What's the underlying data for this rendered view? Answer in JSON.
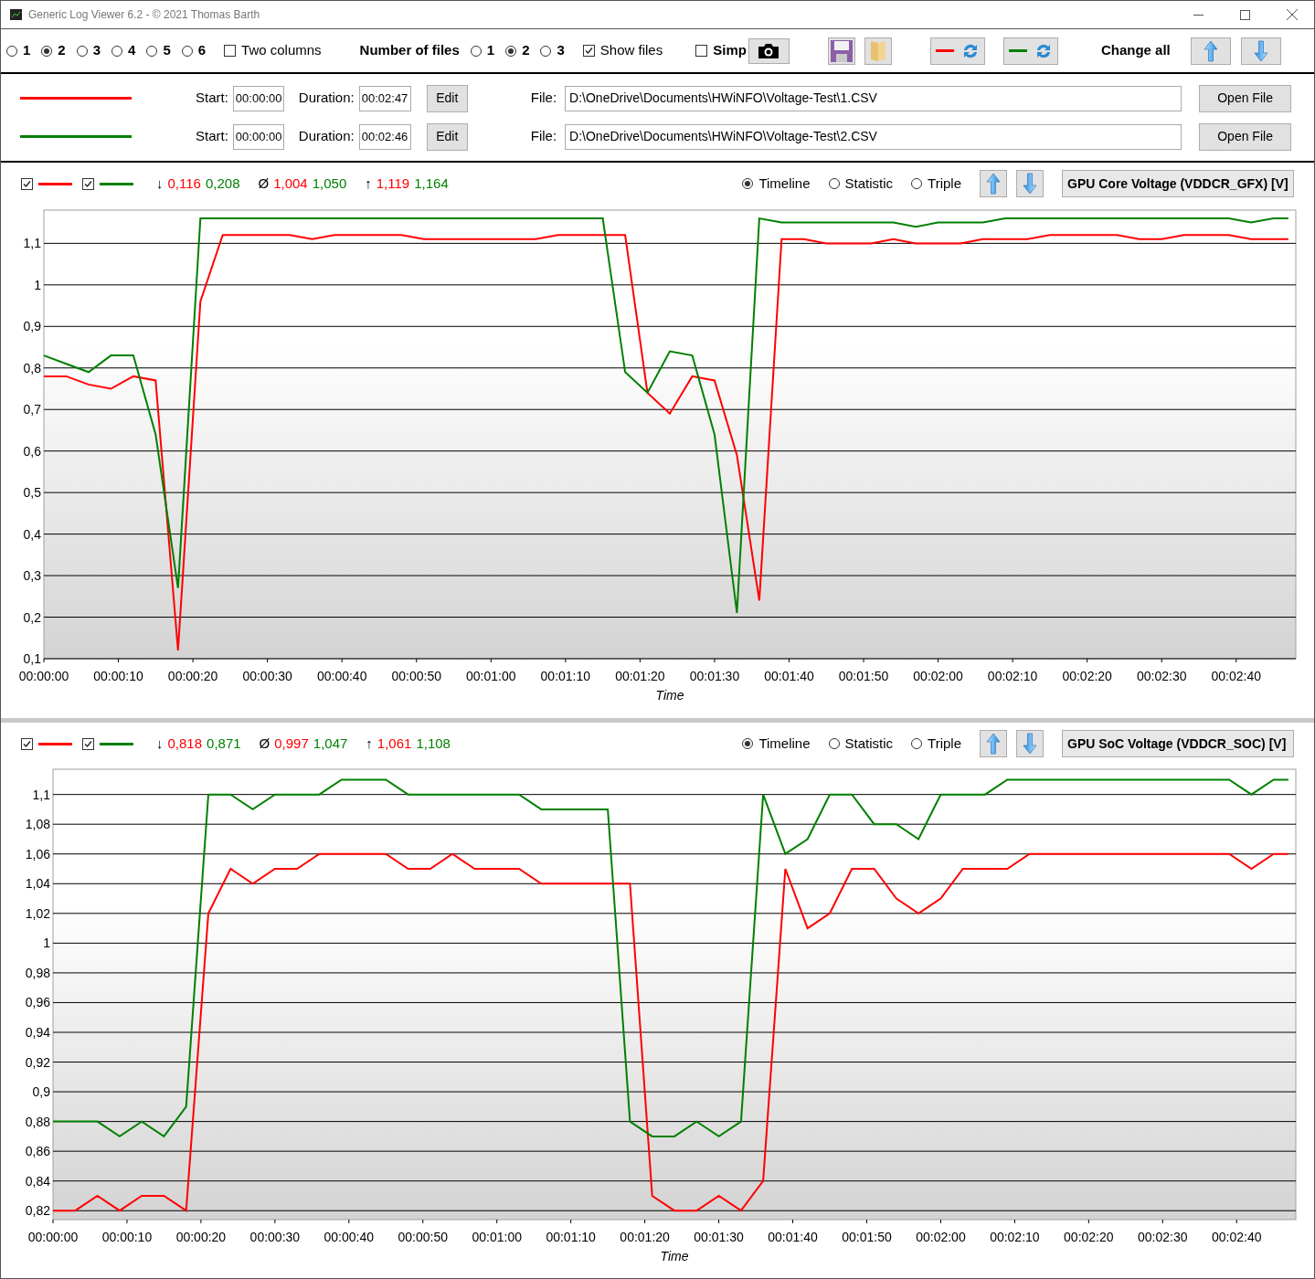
{
  "window": {
    "title": "Generic Log Viewer 6.2 - © 2021 Thomas Barth"
  },
  "toolbar": {
    "layouts": [
      {
        "label": "1",
        "selected": false
      },
      {
        "label": "2",
        "selected": true
      },
      {
        "label": "3",
        "selected": false
      },
      {
        "label": "4",
        "selected": false
      },
      {
        "label": "5",
        "selected": false
      },
      {
        "label": "6",
        "selected": false
      }
    ],
    "two_columns": {
      "label": "Two columns",
      "checked": false
    },
    "number_of_files": {
      "label": "Number of files",
      "options": [
        {
          "label": "1",
          "selected": false
        },
        {
          "label": "2",
          "selected": true
        },
        {
          "label": "3",
          "selected": false
        }
      ]
    },
    "show_files": {
      "label": "Show files",
      "checked": true
    },
    "simple": {
      "label": "Simp",
      "checked": false
    },
    "change_all": {
      "label": "Change all"
    }
  },
  "files": [
    {
      "color": "#ff0000",
      "start_label": "Start:",
      "start": "00:00:00",
      "duration_label": "Duration:",
      "duration": "00:02:47",
      "edit": "Edit",
      "file_label": "File:",
      "path": "D:\\OneDrive\\Documents\\HWiNFO\\Voltage-Test\\1.CSV",
      "open": "Open File"
    },
    {
      "color": "#008000",
      "start_label": "Start:",
      "start": "00:00:00",
      "duration_label": "Duration:",
      "duration": "00:02:46",
      "edit": "Edit",
      "file_label": "File:",
      "path": "D:\\OneDrive\\Documents\\HWiNFO\\Voltage-Test\\2.CSV",
      "open": "Open File"
    }
  ],
  "charts": [
    {
      "toggles": [
        {
          "checked": true,
          "color": "#ff0000"
        },
        {
          "checked": true,
          "color": "#008000"
        }
      ],
      "stats": [
        {
          "symbol": "↓",
          "values": [
            {
              "text": "0,116",
              "color": "#ff0000"
            },
            {
              "text": "0,208",
              "color": "#008000"
            }
          ]
        },
        {
          "symbol": "Ø",
          "values": [
            {
              "text": "1,004",
              "color": "#ff0000"
            },
            {
              "text": "1,050",
              "color": "#008000"
            }
          ]
        },
        {
          "symbol": "↑",
          "values": [
            {
              "text": "1,119",
              "color": "#ff0000"
            },
            {
              "text": "1,164",
              "color": "#008000"
            }
          ]
        }
      ],
      "modes": [
        {
          "label": "Timeline",
          "selected": true
        },
        {
          "label": "Statistic",
          "selected": false
        },
        {
          "label": "Triple",
          "selected": false
        }
      ],
      "sensor": "GPU Core Voltage (VDDCR_GFX) [V]",
      "chart_data": {
        "type": "line",
        "grid": true,
        "xlabel": "Time",
        "xlim": [
          0,
          168
        ],
        "ylim": [
          0.1,
          1.18
        ],
        "x": [
          0,
          3,
          6,
          9,
          12,
          15,
          18,
          21,
          24,
          27,
          30,
          33,
          36,
          39,
          42,
          45,
          48,
          51,
          54,
          57,
          60,
          63,
          66,
          69,
          72,
          75,
          78,
          81,
          84,
          87,
          90,
          93,
          96,
          99,
          102,
          105,
          108,
          111,
          114,
          117,
          120,
          123,
          126,
          129,
          132,
          135,
          138,
          141,
          144,
          147,
          150,
          153,
          156,
          159,
          162,
          165,
          167
        ],
        "series": [
          {
            "color": "#ff0000",
            "values": [
              0.78,
              0.78,
              0.76,
              0.75,
              0.78,
              0.77,
              0.12,
              0.96,
              1.12,
              1.12,
              1.12,
              1.12,
              1.11,
              1.12,
              1.12,
              1.12,
              1.12,
              1.11,
              1.11,
              1.11,
              1.11,
              1.11,
              1.11,
              1.12,
              1.12,
              1.12,
              1.12,
              0.74,
              0.69,
              0.78,
              0.77,
              0.59,
              0.24,
              1.11,
              1.11,
              1.1,
              1.1,
              1.1,
              1.11,
              1.1,
              1.1,
              1.1,
              1.11,
              1.11,
              1.11,
              1.12,
              1.12,
              1.12,
              1.12,
              1.11,
              1.11,
              1.12,
              1.12,
              1.12,
              1.11,
              1.11,
              1.11
            ]
          },
          {
            "color": "#008000",
            "values": [
              0.83,
              0.81,
              0.79,
              0.83,
              0.83,
              0.64,
              0.27,
              1.16,
              1.16,
              1.16,
              1.16,
              1.16,
              1.16,
              1.16,
              1.16,
              1.16,
              1.16,
              1.16,
              1.16,
              1.16,
              1.16,
              1.16,
              1.16,
              1.16,
              1.16,
              1.16,
              0.79,
              0.74,
              0.84,
              0.83,
              0.64,
              0.21,
              1.16,
              1.15,
              1.15,
              1.15,
              1.15,
              1.15,
              1.15,
              1.14,
              1.15,
              1.15,
              1.15,
              1.16,
              1.16,
              1.16,
              1.16,
              1.16,
              1.16,
              1.16,
              1.16,
              1.16,
              1.16,
              1.16,
              1.15,
              1.16,
              1.16
            ]
          }
        ],
        "xticks": [
          {
            "value": 0,
            "label": "00:00:00"
          },
          {
            "value": 10,
            "label": "00:00:10"
          },
          {
            "value": 20,
            "label": "00:00:20"
          },
          {
            "value": 30,
            "label": "00:00:30"
          },
          {
            "value": 40,
            "label": "00:00:40"
          },
          {
            "value": 50,
            "label": "00:00:50"
          },
          {
            "value": 60,
            "label": "00:01:00"
          },
          {
            "value": 70,
            "label": "00:01:10"
          },
          {
            "value": 80,
            "label": "00:01:20"
          },
          {
            "value": 90,
            "label": "00:01:30"
          },
          {
            "value": 100,
            "label": "00:01:40"
          },
          {
            "value": 110,
            "label": "00:01:50"
          },
          {
            "value": 120,
            "label": "00:02:00"
          },
          {
            "value": 130,
            "label": "00:02:10"
          },
          {
            "value": 140,
            "label": "00:02:20"
          },
          {
            "value": 150,
            "label": "00:02:30"
          },
          {
            "value": 160,
            "label": "00:02:40"
          }
        ],
        "yticks": [
          {
            "value": 0.1,
            "label": "0,1"
          },
          {
            "value": 0.2,
            "label": "0,2"
          },
          {
            "value": 0.3,
            "label": "0,3"
          },
          {
            "value": 0.4,
            "label": "0,4"
          },
          {
            "value": 0.5,
            "label": "0,5"
          },
          {
            "value": 0.6,
            "label": "0,6"
          },
          {
            "value": 0.7,
            "label": "0,7"
          },
          {
            "value": 0.8,
            "label": "0,8"
          },
          {
            "value": 0.9,
            "label": "0,9"
          },
          {
            "value": 1,
            "label": "1"
          },
          {
            "value": 1.1,
            "label": "1,1"
          }
        ]
      }
    },
    {
      "toggles": [
        {
          "checked": true,
          "color": "#ff0000"
        },
        {
          "checked": true,
          "color": "#008000"
        }
      ],
      "stats": [
        {
          "symbol": "↓",
          "values": [
            {
              "text": "0,818",
              "color": "#ff0000"
            },
            {
              "text": "0,871",
              "color": "#008000"
            }
          ]
        },
        {
          "symbol": "Ø",
          "values": [
            {
              "text": "0,997",
              "color": "#ff0000"
            },
            {
              "text": "1,047",
              "color": "#008000"
            }
          ]
        },
        {
          "symbol": "↑",
          "values": [
            {
              "text": "1,061",
              "color": "#ff0000"
            },
            {
              "text": "1,108",
              "color": "#008000"
            }
          ]
        }
      ],
      "modes": [
        {
          "label": "Timeline",
          "selected": true
        },
        {
          "label": "Statistic",
          "selected": false
        },
        {
          "label": "Triple",
          "selected": false
        }
      ],
      "sensor": "GPU SoC Voltage (VDDCR_SOC) [V]",
      "chart_data": {
        "type": "line",
        "grid": true,
        "xlabel": "Time",
        "xlim": [
          0,
          168
        ],
        "ylim": [
          0.814,
          1.117
        ],
        "x": [
          0,
          3,
          6,
          9,
          12,
          15,
          18,
          21,
          24,
          27,
          30,
          33,
          36,
          39,
          42,
          45,
          48,
          51,
          54,
          57,
          60,
          63,
          66,
          69,
          72,
          75,
          78,
          81,
          84,
          87,
          90,
          93,
          96,
          99,
          102,
          105,
          108,
          111,
          114,
          117,
          120,
          123,
          126,
          129,
          132,
          135,
          138,
          141,
          144,
          147,
          150,
          153,
          156,
          159,
          162,
          165,
          167
        ],
        "series": [
          {
            "color": "#ff0000",
            "values": [
              0.82,
              0.82,
              0.83,
              0.82,
              0.83,
              0.83,
              0.82,
              1.02,
              1.05,
              1.04,
              1.05,
              1.05,
              1.06,
              1.06,
              1.06,
              1.06,
              1.05,
              1.05,
              1.06,
              1.05,
              1.05,
              1.05,
              1.04,
              1.04,
              1.04,
              1.04,
              1.04,
              0.83,
              0.82,
              0.82,
              0.83,
              0.82,
              0.84,
              1.05,
              1.01,
              1.02,
              1.05,
              1.05,
              1.03,
              1.02,
              1.03,
              1.05,
              1.05,
              1.05,
              1.06,
              1.06,
              1.06,
              1.06,
              1.06,
              1.06,
              1.06,
              1.06,
              1.06,
              1.06,
              1.05,
              1.06,
              1.06
            ]
          },
          {
            "color": "#008000",
            "values": [
              0.88,
              0.88,
              0.88,
              0.87,
              0.88,
              0.87,
              0.89,
              1.1,
              1.1,
              1.09,
              1.1,
              1.1,
              1.1,
              1.11,
              1.11,
              1.11,
              1.1,
              1.1,
              1.1,
              1.1,
              1.1,
              1.1,
              1.09,
              1.09,
              1.09,
              1.09,
              0.88,
              0.87,
              0.87,
              0.88,
              0.87,
              0.88,
              1.1,
              1.06,
              1.07,
              1.1,
              1.1,
              1.08,
              1.08,
              1.07,
              1.1,
              1.1,
              1.1,
              1.11,
              1.11,
              1.11,
              1.11,
              1.11,
              1.11,
              1.11,
              1.11,
              1.11,
              1.11,
              1.11,
              1.1,
              1.11,
              1.11
            ]
          }
        ],
        "xticks": [
          {
            "value": 0,
            "label": "00:00:00"
          },
          {
            "value": 10,
            "label": "00:00:10"
          },
          {
            "value": 20,
            "label": "00:00:20"
          },
          {
            "value": 30,
            "label": "00:00:30"
          },
          {
            "value": 40,
            "label": "00:00:40"
          },
          {
            "value": 50,
            "label": "00:00:50"
          },
          {
            "value": 60,
            "label": "00:01:00"
          },
          {
            "value": 70,
            "label": "00:01:10"
          },
          {
            "value": 80,
            "label": "00:01:20"
          },
          {
            "value": 90,
            "label": "00:01:30"
          },
          {
            "value": 100,
            "label": "00:01:40"
          },
          {
            "value": 110,
            "label": "00:01:50"
          },
          {
            "value": 120,
            "label": "00:02:00"
          },
          {
            "value": 130,
            "label": "00:02:10"
          },
          {
            "value": 140,
            "label": "00:02:20"
          },
          {
            "value": 150,
            "label": "00:02:30"
          },
          {
            "value": 160,
            "label": "00:02:40"
          }
        ],
        "yticks": [
          {
            "value": 0.82,
            "label": "0,82"
          },
          {
            "value": 0.84,
            "label": "0,84"
          },
          {
            "value": 0.86,
            "label": "0,86"
          },
          {
            "value": 0.88,
            "label": "0,88"
          },
          {
            "value": 0.9,
            "label": "0,9"
          },
          {
            "value": 0.92,
            "label": "0,92"
          },
          {
            "value": 0.94,
            "label": "0,94"
          },
          {
            "value": 0.96,
            "label": "0,96"
          },
          {
            "value": 0.98,
            "label": "0,98"
          },
          {
            "value": 1,
            "label": "1"
          },
          {
            "value": 1.02,
            "label": "1,02"
          },
          {
            "value": 1.04,
            "label": "1,04"
          },
          {
            "value": 1.06,
            "label": "1,06"
          },
          {
            "value": 1.08,
            "label": "1,08"
          },
          {
            "value": 1.1,
            "label": "1,1"
          }
        ]
      }
    }
  ]
}
